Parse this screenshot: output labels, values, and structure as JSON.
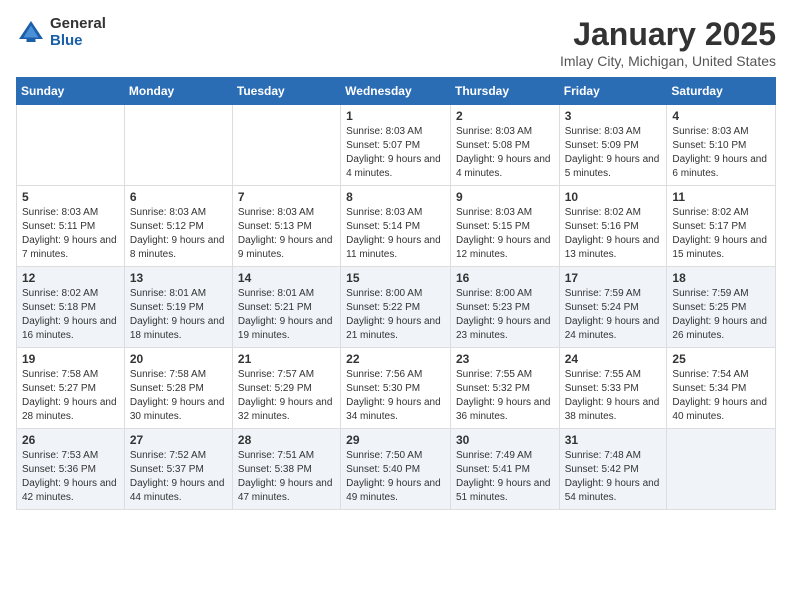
{
  "header": {
    "logo": {
      "general": "General",
      "blue": "Blue"
    },
    "title": "January 2025",
    "location": "Imlay City, Michigan, United States"
  },
  "weekdays": [
    "Sunday",
    "Monday",
    "Tuesday",
    "Wednesday",
    "Thursday",
    "Friday",
    "Saturday"
  ],
  "weeks": [
    [
      {
        "day": "",
        "sunrise": "",
        "sunset": "",
        "daylight": ""
      },
      {
        "day": "",
        "sunrise": "",
        "sunset": "",
        "daylight": ""
      },
      {
        "day": "",
        "sunrise": "",
        "sunset": "",
        "daylight": ""
      },
      {
        "day": "1",
        "sunrise": "Sunrise: 8:03 AM",
        "sunset": "Sunset: 5:07 PM",
        "daylight": "Daylight: 9 hours and 4 minutes."
      },
      {
        "day": "2",
        "sunrise": "Sunrise: 8:03 AM",
        "sunset": "Sunset: 5:08 PM",
        "daylight": "Daylight: 9 hours and 4 minutes."
      },
      {
        "day": "3",
        "sunrise": "Sunrise: 8:03 AM",
        "sunset": "Sunset: 5:09 PM",
        "daylight": "Daylight: 9 hours and 5 minutes."
      },
      {
        "day": "4",
        "sunrise": "Sunrise: 8:03 AM",
        "sunset": "Sunset: 5:10 PM",
        "daylight": "Daylight: 9 hours and 6 minutes."
      }
    ],
    [
      {
        "day": "5",
        "sunrise": "Sunrise: 8:03 AM",
        "sunset": "Sunset: 5:11 PM",
        "daylight": "Daylight: 9 hours and 7 minutes."
      },
      {
        "day": "6",
        "sunrise": "Sunrise: 8:03 AM",
        "sunset": "Sunset: 5:12 PM",
        "daylight": "Daylight: 9 hours and 8 minutes."
      },
      {
        "day": "7",
        "sunrise": "Sunrise: 8:03 AM",
        "sunset": "Sunset: 5:13 PM",
        "daylight": "Daylight: 9 hours and 9 minutes."
      },
      {
        "day": "8",
        "sunrise": "Sunrise: 8:03 AM",
        "sunset": "Sunset: 5:14 PM",
        "daylight": "Daylight: 9 hours and 11 minutes."
      },
      {
        "day": "9",
        "sunrise": "Sunrise: 8:03 AM",
        "sunset": "Sunset: 5:15 PM",
        "daylight": "Daylight: 9 hours and 12 minutes."
      },
      {
        "day": "10",
        "sunrise": "Sunrise: 8:02 AM",
        "sunset": "Sunset: 5:16 PM",
        "daylight": "Daylight: 9 hours and 13 minutes."
      },
      {
        "day": "11",
        "sunrise": "Sunrise: 8:02 AM",
        "sunset": "Sunset: 5:17 PM",
        "daylight": "Daylight: 9 hours and 15 minutes."
      }
    ],
    [
      {
        "day": "12",
        "sunrise": "Sunrise: 8:02 AM",
        "sunset": "Sunset: 5:18 PM",
        "daylight": "Daylight: 9 hours and 16 minutes."
      },
      {
        "day": "13",
        "sunrise": "Sunrise: 8:01 AM",
        "sunset": "Sunset: 5:19 PM",
        "daylight": "Daylight: 9 hours and 18 minutes."
      },
      {
        "day": "14",
        "sunrise": "Sunrise: 8:01 AM",
        "sunset": "Sunset: 5:21 PM",
        "daylight": "Daylight: 9 hours and 19 minutes."
      },
      {
        "day": "15",
        "sunrise": "Sunrise: 8:00 AM",
        "sunset": "Sunset: 5:22 PM",
        "daylight": "Daylight: 9 hours and 21 minutes."
      },
      {
        "day": "16",
        "sunrise": "Sunrise: 8:00 AM",
        "sunset": "Sunset: 5:23 PM",
        "daylight": "Daylight: 9 hours and 23 minutes."
      },
      {
        "day": "17",
        "sunrise": "Sunrise: 7:59 AM",
        "sunset": "Sunset: 5:24 PM",
        "daylight": "Daylight: 9 hours and 24 minutes."
      },
      {
        "day": "18",
        "sunrise": "Sunrise: 7:59 AM",
        "sunset": "Sunset: 5:25 PM",
        "daylight": "Daylight: 9 hours and 26 minutes."
      }
    ],
    [
      {
        "day": "19",
        "sunrise": "Sunrise: 7:58 AM",
        "sunset": "Sunset: 5:27 PM",
        "daylight": "Daylight: 9 hours and 28 minutes."
      },
      {
        "day": "20",
        "sunrise": "Sunrise: 7:58 AM",
        "sunset": "Sunset: 5:28 PM",
        "daylight": "Daylight: 9 hours and 30 minutes."
      },
      {
        "day": "21",
        "sunrise": "Sunrise: 7:57 AM",
        "sunset": "Sunset: 5:29 PM",
        "daylight": "Daylight: 9 hours and 32 minutes."
      },
      {
        "day": "22",
        "sunrise": "Sunrise: 7:56 AM",
        "sunset": "Sunset: 5:30 PM",
        "daylight": "Daylight: 9 hours and 34 minutes."
      },
      {
        "day": "23",
        "sunrise": "Sunrise: 7:55 AM",
        "sunset": "Sunset: 5:32 PM",
        "daylight": "Daylight: 9 hours and 36 minutes."
      },
      {
        "day": "24",
        "sunrise": "Sunrise: 7:55 AM",
        "sunset": "Sunset: 5:33 PM",
        "daylight": "Daylight: 9 hours and 38 minutes."
      },
      {
        "day": "25",
        "sunrise": "Sunrise: 7:54 AM",
        "sunset": "Sunset: 5:34 PM",
        "daylight": "Daylight: 9 hours and 40 minutes."
      }
    ],
    [
      {
        "day": "26",
        "sunrise": "Sunrise: 7:53 AM",
        "sunset": "Sunset: 5:36 PM",
        "daylight": "Daylight: 9 hours and 42 minutes."
      },
      {
        "day": "27",
        "sunrise": "Sunrise: 7:52 AM",
        "sunset": "Sunset: 5:37 PM",
        "daylight": "Daylight: 9 hours and 44 minutes."
      },
      {
        "day": "28",
        "sunrise": "Sunrise: 7:51 AM",
        "sunset": "Sunset: 5:38 PM",
        "daylight": "Daylight: 9 hours and 47 minutes."
      },
      {
        "day": "29",
        "sunrise": "Sunrise: 7:50 AM",
        "sunset": "Sunset: 5:40 PM",
        "daylight": "Daylight: 9 hours and 49 minutes."
      },
      {
        "day": "30",
        "sunrise": "Sunrise: 7:49 AM",
        "sunset": "Sunset: 5:41 PM",
        "daylight": "Daylight: 9 hours and 51 minutes."
      },
      {
        "day": "31",
        "sunrise": "Sunrise: 7:48 AM",
        "sunset": "Sunset: 5:42 PM",
        "daylight": "Daylight: 9 hours and 54 minutes."
      },
      {
        "day": "",
        "sunrise": "",
        "sunset": "",
        "daylight": ""
      }
    ]
  ]
}
